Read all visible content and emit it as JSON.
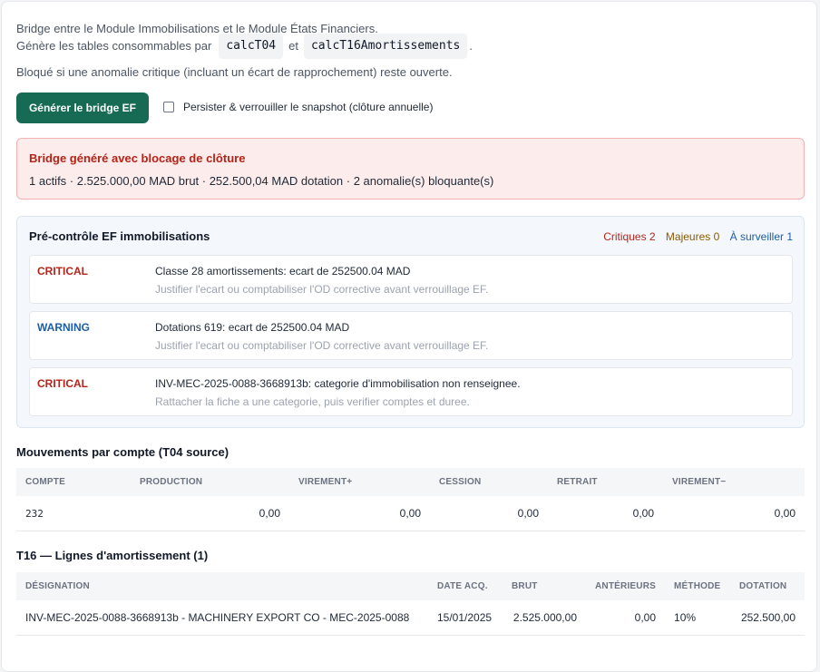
{
  "intro": {
    "line1": "Bridge entre le Module Immobilisations et le Module États Financiers.",
    "line2_prefix": "Génère les tables consommables par",
    "code1": "calcT04",
    "line2_middle": "et",
    "code2": "calcT16Amortissements",
    "line2_suffix": ".",
    "line3": "Bloqué si une anomalie critique (incluant un écart de rapprochement) reste ouverte."
  },
  "actions": {
    "generate_label": "Générer le bridge EF",
    "persist_label": "Persister & verrouiller le snapshot (clôture annuelle)",
    "persist_checked": false
  },
  "alert": {
    "title": "Bridge généré avec blocage de clôture",
    "body": "1 actifs · 2.525.000,00 MAD brut · 252.500,04 MAD dotation · 2 anomalie(s) bloquante(s)"
  },
  "precheck": {
    "title": "Pré-contrôle EF immobilisations",
    "counts": {
      "critical": "Critiques 2",
      "major": "Majeures 0",
      "watch": "À surveiller 1"
    },
    "issues": [
      {
        "level": "CRITICAL",
        "message": "Classe 28 amortissements: ecart de 252500.04 MAD",
        "hint": "Justifier l'ecart ou comptabiliser l'OD corrective avant verrouillage EF."
      },
      {
        "level": "WARNING",
        "message": "Dotations 619: ecart de 252500.04 MAD",
        "hint": "Justifier l'ecart ou comptabiliser l'OD corrective avant verrouillage EF."
      },
      {
        "level": "CRITICAL",
        "message": "INV-MEC-2025-0088-3668913b: categorie d'immobilisation non renseignee.",
        "hint": "Rattacher la fiche a une categorie, puis verifier comptes et duree."
      }
    ]
  },
  "t04": {
    "title": "Mouvements par compte (T04 source)",
    "headers": [
      "COMPTE",
      "PRODUCTION",
      "VIREMENT+",
      "CESSION",
      "RETRAIT",
      "VIREMENT−"
    ],
    "rows": [
      [
        "232",
        "0,00",
        "0,00",
        "0,00",
        "0,00",
        "0,00"
      ]
    ]
  },
  "t16": {
    "title": "T16 — Lignes d'amortissement (1)",
    "headers": [
      "DÉSIGNATION",
      "DATE ACQ.",
      "BRUT",
      "ANTÉRIEURS",
      "MÉTHODE",
      "DOTATION"
    ],
    "rows": [
      [
        "INV-MEC-2025-0088-3668913b - MACHINERY EXPORT CO - MEC-2025-0088",
        "15/01/2025",
        "2.525.000,00",
        "0,00",
        "10%",
        "252.500,00"
      ]
    ]
  }
}
